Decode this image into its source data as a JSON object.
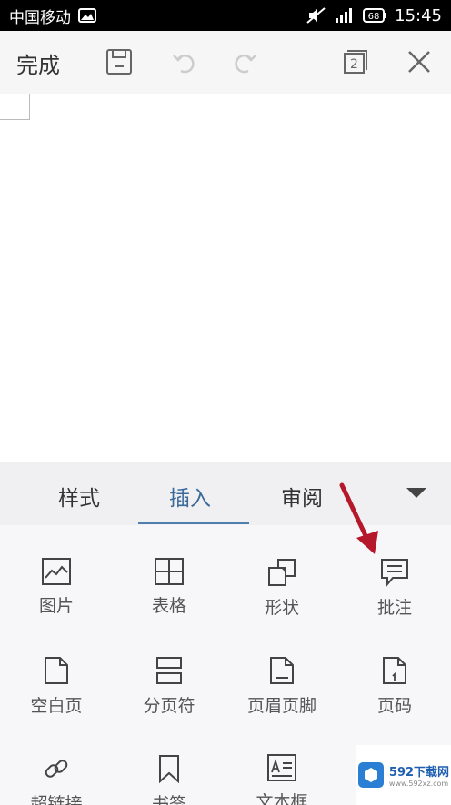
{
  "status_bar": {
    "carrier": "中国移动",
    "battery": "68",
    "time": "15:45"
  },
  "toolbar": {
    "done_label": "完成",
    "doc_count": "2"
  },
  "tabs": [
    {
      "label": "样式"
    },
    {
      "label": "插入",
      "active": true
    },
    {
      "label": "审阅"
    }
  ],
  "insert_items": [
    {
      "label": "图片",
      "icon": "image-icon"
    },
    {
      "label": "表格",
      "icon": "table-icon"
    },
    {
      "label": "形状",
      "icon": "shape-icon"
    },
    {
      "label": "批注",
      "icon": "comment-icon"
    },
    {
      "label": "空白页",
      "icon": "blank-page-icon"
    },
    {
      "label": "分页符",
      "icon": "page-break-icon"
    },
    {
      "label": "页眉页脚",
      "icon": "header-footer-icon"
    },
    {
      "label": "页码",
      "icon": "page-number-icon"
    },
    {
      "label": "超链接",
      "icon": "link-icon"
    },
    {
      "label": "书签",
      "icon": "bookmark-icon"
    },
    {
      "label": "文本框",
      "icon": "textbox-icon"
    }
  ],
  "watermark": {
    "brand": "592下载网",
    "url": "www.592xz.com"
  },
  "colors": {
    "accent": "#4f7fae",
    "annotation_arrow": "#b5172b"
  }
}
